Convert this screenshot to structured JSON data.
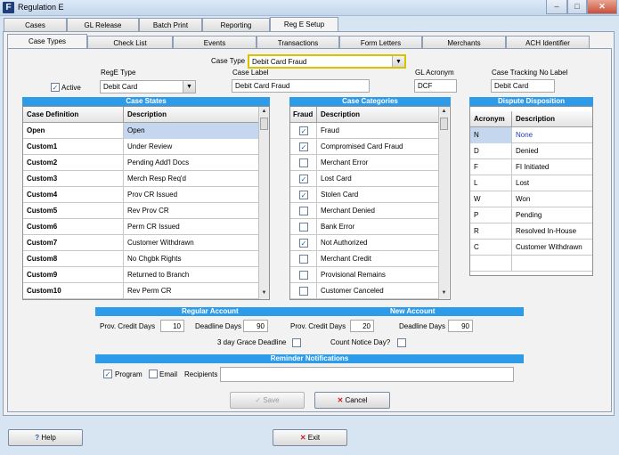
{
  "window": {
    "title": "Regulation E",
    "app_icon": "F"
  },
  "top_tabs": [
    "Cases",
    "GL Release",
    "Batch Print",
    "Reporting",
    "Reg E Setup"
  ],
  "sub_tabs": [
    "Case Types",
    "Check List",
    "Events",
    "Transactions",
    "Form Letters",
    "Merchants",
    "ACH Identifier"
  ],
  "form": {
    "case_type_label": "Case Type",
    "case_type_value": "Debit Card Fraud",
    "active_label": "Active",
    "rege_type_label": "RegE Type",
    "rege_type_value": "Debit Card",
    "case_label_label": "Case Label",
    "case_label_value": "Debit Card Fraud",
    "gl_acronym_label": "GL Acronym",
    "gl_acronym_value": "DCF",
    "tracking_label": "Case Tracking No Label",
    "tracking_value": "Debit Card"
  },
  "case_states": {
    "title": "Case States",
    "headers": [
      "Case Definition",
      "Description"
    ],
    "rows": [
      [
        "Open",
        "Open"
      ],
      [
        "Custom1",
        "Under Review"
      ],
      [
        "Custom2",
        "Pending Add'l Docs"
      ],
      [
        "Custom3",
        "Merch Resp Req'd"
      ],
      [
        "Custom4",
        "Prov CR Issued"
      ],
      [
        "Custom5",
        "Rev Prov CR"
      ],
      [
        "Custom6",
        "Perm CR Issued"
      ],
      [
        "Custom7",
        "Customer Withdrawn"
      ],
      [
        "Custom8",
        "No Chgbk Rights"
      ],
      [
        "Custom9",
        "Returned to Branch"
      ],
      [
        "Custom10",
        "Rev Perm CR"
      ]
    ]
  },
  "case_categories": {
    "title": "Case Categories",
    "headers": [
      "Fraud",
      "Description"
    ],
    "rows": [
      {
        "checked": true,
        "desc": "Fraud"
      },
      {
        "checked": true,
        "desc": "Compromised Card Fraud"
      },
      {
        "checked": false,
        "desc": "Merchant Error"
      },
      {
        "checked": true,
        "desc": "Lost Card"
      },
      {
        "checked": true,
        "desc": "Stolen Card"
      },
      {
        "checked": false,
        "desc": "Merchant Denied"
      },
      {
        "checked": false,
        "desc": "Bank Error"
      },
      {
        "checked": true,
        "desc": "Not Authorized"
      },
      {
        "checked": false,
        "desc": "Merchant Credit"
      },
      {
        "checked": false,
        "desc": "Provisional Remains"
      },
      {
        "checked": false,
        "desc": "Customer Canceled"
      }
    ]
  },
  "dispute_disposition": {
    "title": "Dispute Disposition",
    "headers": [
      "Acronym",
      "Description"
    ],
    "rows": [
      [
        "N",
        "None"
      ],
      [
        "D",
        "Denied"
      ],
      [
        "F",
        "FI Initiated"
      ],
      [
        "L",
        "Lost"
      ],
      [
        "W",
        "Won"
      ],
      [
        "P",
        "Pending"
      ],
      [
        "R",
        "Resolved In-House"
      ],
      [
        "C",
        "Customer Withdrawn"
      ]
    ]
  },
  "accounts": {
    "regular_title": "Regular Account",
    "new_title": "New Account",
    "prov_credit_label": "Prov. Credit Days",
    "deadline_label": "Deadline Days",
    "regular_prov": "10",
    "regular_deadline": "90",
    "new_prov": "20",
    "new_deadline": "90",
    "grace_label": "3 day Grace Deadline",
    "count_notice_label": "Count Notice Day?"
  },
  "reminder": {
    "title": "Reminder Notifications",
    "program_label": "Program",
    "email_label": "Email",
    "recipients_label": "Recipients",
    "recipients_value": ""
  },
  "buttons": {
    "save": "Save",
    "cancel": "Cancel",
    "help": "Help",
    "exit": "Exit"
  },
  "colors": {
    "section_header": "#2e9be8",
    "selected_row": "#c5d7ee",
    "accent_yellow": "#d8c300"
  }
}
